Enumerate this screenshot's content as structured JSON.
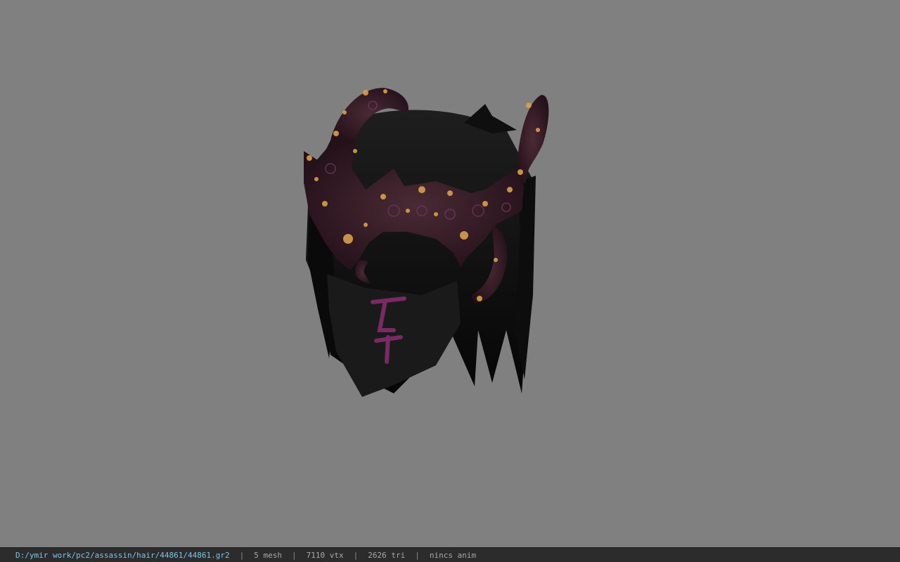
{
  "viewport": {
    "background_color": "#808080",
    "model": {
      "icon": "hair-model-icon",
      "colors": {
        "hair": "#0b0b0b",
        "headband": "#3a1f2a",
        "ornament": "#d9a04a",
        "mask_glyph": "#8a2a6a"
      }
    }
  },
  "status_bar": {
    "file_path": "D:/ymir work/pc2/assassin/hair/44861/44861.gr2",
    "separator": "|",
    "mesh": "5 mesh",
    "vertices": "7110 vtx",
    "triangles": "2626 tri",
    "animation": "nincs anim"
  }
}
